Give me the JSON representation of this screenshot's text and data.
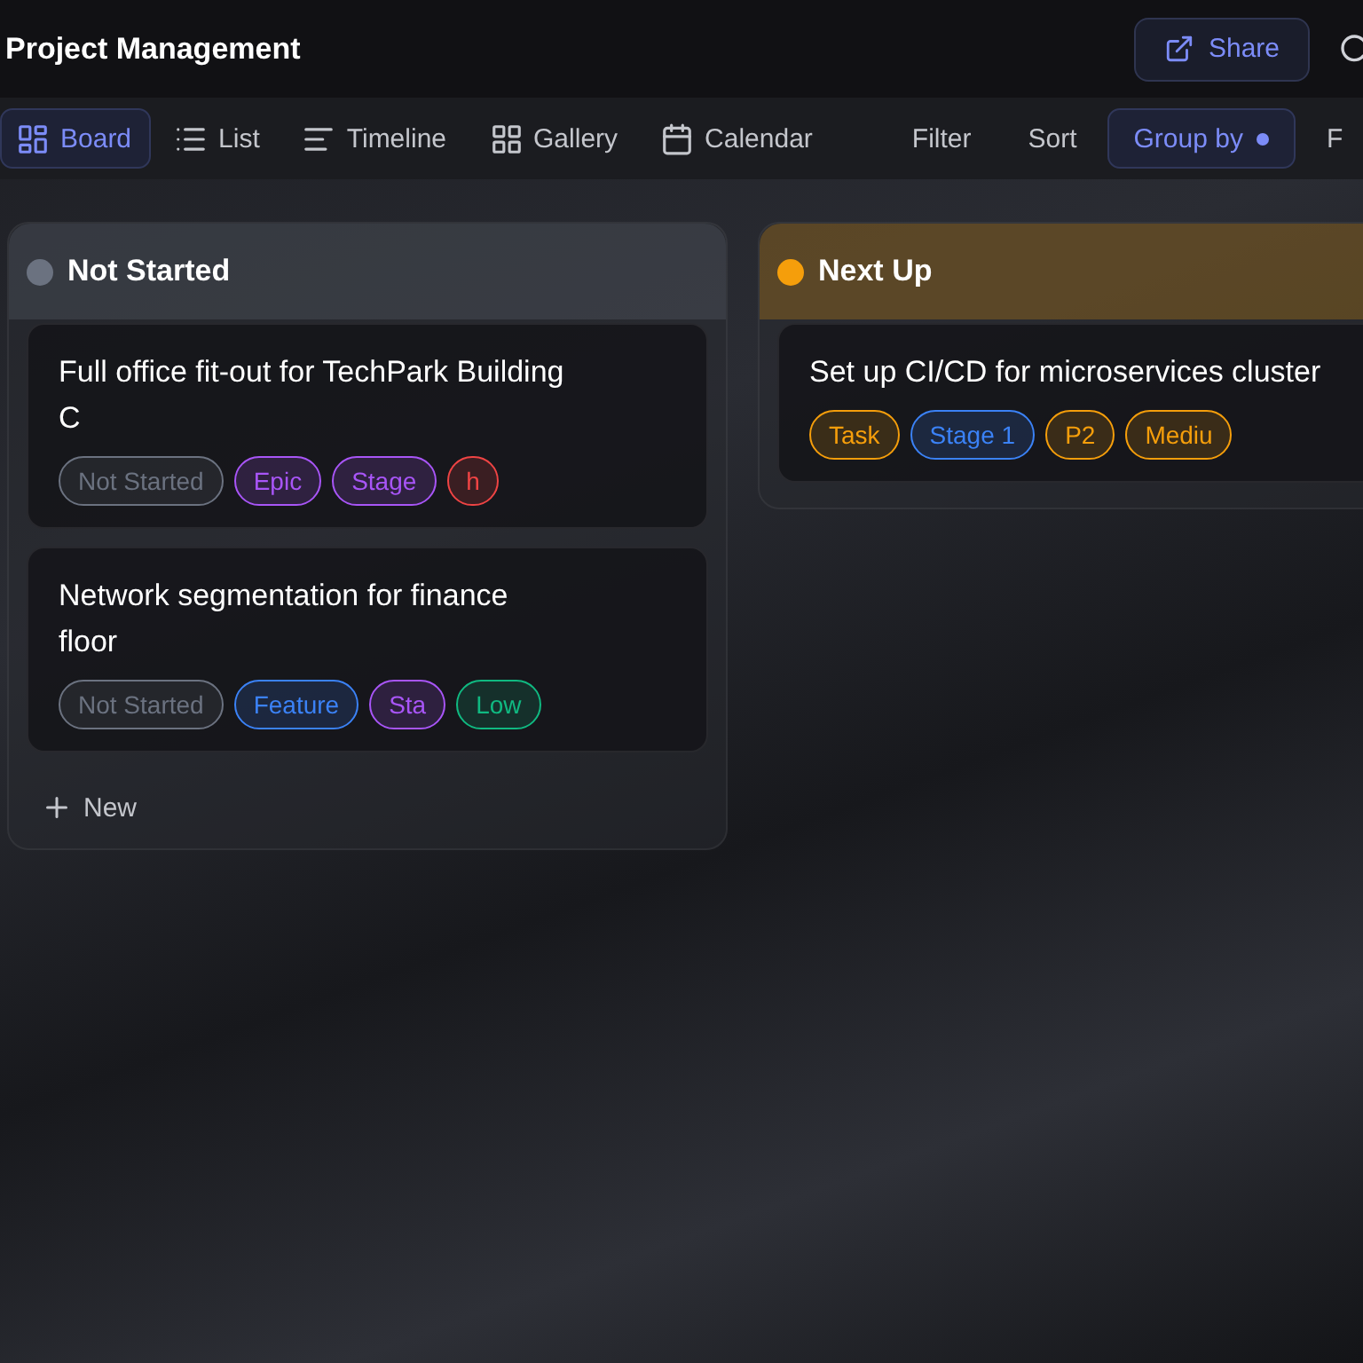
{
  "header": {
    "title": "Project Management",
    "share_label": "Share"
  },
  "views": [
    {
      "label": "Board",
      "selected": true
    },
    {
      "label": "List",
      "selected": false
    },
    {
      "label": "Timeline",
      "selected": false
    },
    {
      "label": "Gallery",
      "selected": false
    },
    {
      "label": "Calendar",
      "selected": false
    }
  ],
  "actions": [
    {
      "label": "Filter",
      "active": false
    },
    {
      "label": "Sort",
      "active": false
    },
    {
      "label": "Group by",
      "active": true
    },
    {
      "label": "F",
      "active": false
    }
  ],
  "columns": [
    {
      "title": "Not Started",
      "color": "#6b7280",
      "new_label": "New",
      "cards": [
        {
          "title": "Full office fit-out for TechPark Building C",
          "tags": [
            {
              "text": "Not Started",
              "color": "#6b7280"
            },
            {
              "text": "Epic",
              "color": "#a855f7"
            },
            {
              "text": "Stage",
              "color": "#a855f7"
            },
            {
              "text": "h",
              "color": "#ef4444"
            }
          ]
        },
        {
          "title": "Network segmentation for finance floor",
          "tags": [
            {
              "text": "Not Started",
              "color": "#6b7280"
            },
            {
              "text": "Feature",
              "color": "#3b82f6"
            },
            {
              "text": "Sta",
              "color": "#a855f7"
            },
            {
              "text": "Low",
              "color": "#10b981"
            }
          ]
        }
      ]
    },
    {
      "title": "Next Up",
      "color": "#f59e0b",
      "cards": [
        {
          "title": "Set up CI/CD for microservices cluster",
          "tags": [
            {
              "text": "Task",
              "color": "#f59e0b"
            },
            {
              "text": "Stage 1",
              "color": "#3b82f6"
            },
            {
              "text": "P2",
              "color": "#f59e0b"
            },
            {
              "text": "Mediu",
              "color": "#f59e0b"
            }
          ]
        }
      ]
    }
  ]
}
